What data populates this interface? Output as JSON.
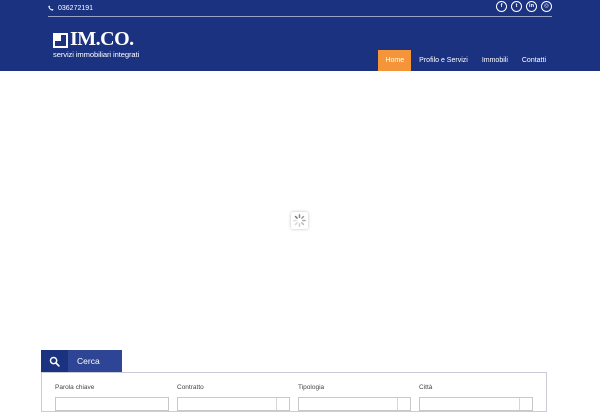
{
  "header": {
    "phone": "036272191",
    "socials": [
      {
        "name": "facebook",
        "glyph": "f"
      },
      {
        "name": "twitter",
        "glyph": "t"
      },
      {
        "name": "linkedin",
        "glyph": "in"
      },
      {
        "name": "instagram",
        "glyph": "◎"
      }
    ],
    "logo": {
      "title": "IM.CO.",
      "tagline": "servizi immobiliari integrati"
    },
    "nav": [
      {
        "label": "Home",
        "active": true
      },
      {
        "label": "Profilo e Servizi",
        "active": false
      },
      {
        "label": "Immobili",
        "active": false
      },
      {
        "label": "Contatti",
        "active": false
      }
    ]
  },
  "search": {
    "tab_label": "Cerca",
    "icon": "search-icon",
    "fields": [
      {
        "label": "Parola chiave",
        "type": "text",
        "value": ""
      },
      {
        "label": "Contratto",
        "type": "select",
        "value": ""
      },
      {
        "label": "Tipologia",
        "type": "select",
        "value": ""
      },
      {
        "label": "Città",
        "type": "select",
        "value": ""
      }
    ]
  },
  "colors": {
    "primary": "#1b3281",
    "accent": "#f5953a",
    "search_label_bg": "#2d4594"
  }
}
